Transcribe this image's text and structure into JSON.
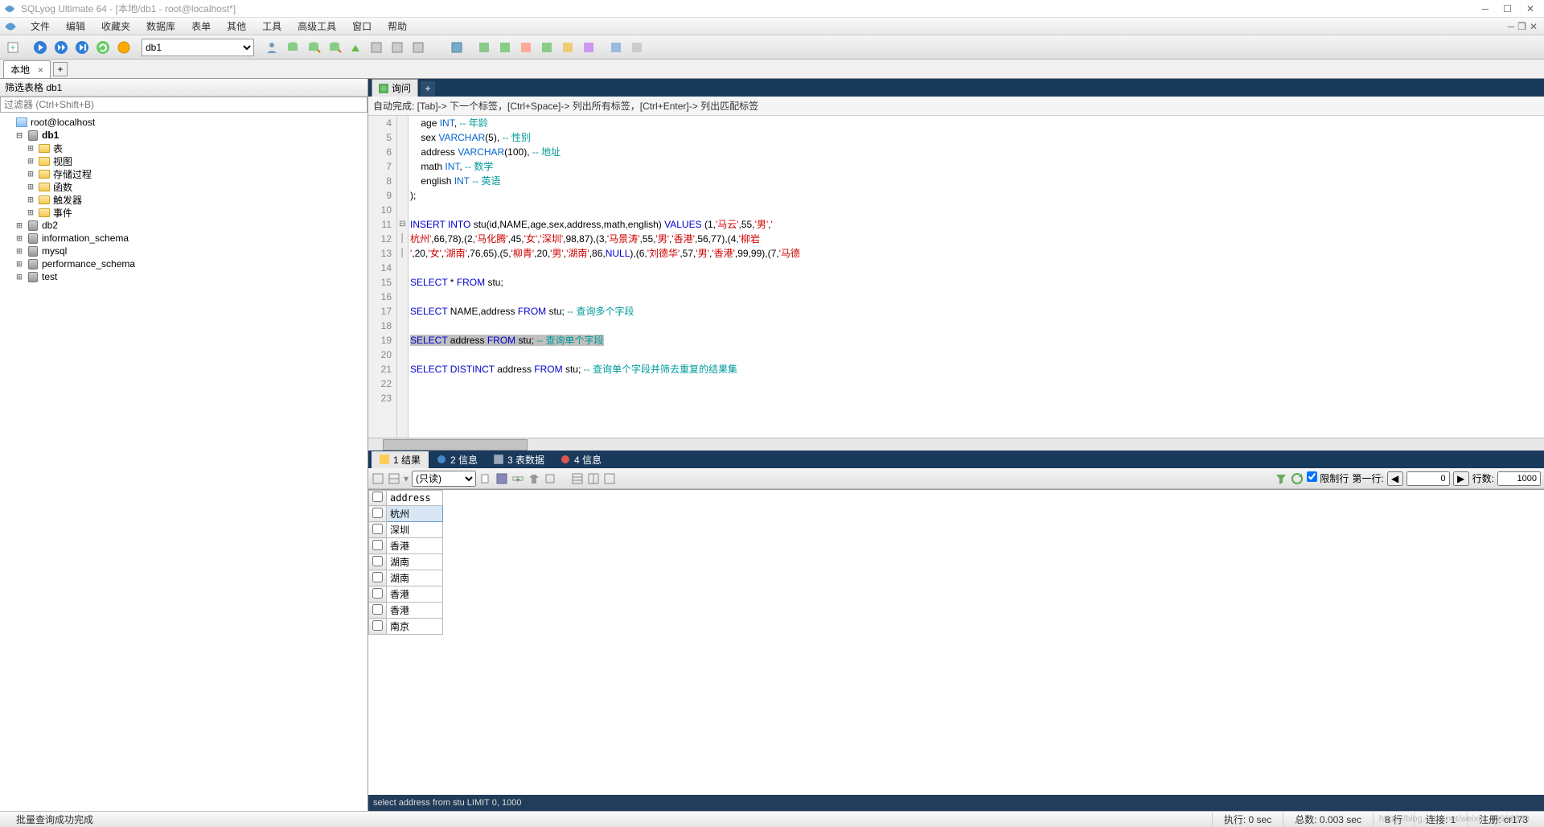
{
  "window": {
    "title": "SQLyog Ultimate 64 - [本地/db1 - root@localhost*]"
  },
  "menubar": {
    "items": [
      "文件",
      "编辑",
      "收藏夹",
      "数据库",
      "表单",
      "其他",
      "工具",
      "高级工具",
      "窗口",
      "帮助"
    ]
  },
  "toolbar": {
    "db_selector": "db1"
  },
  "conn_tab": {
    "label": "本地"
  },
  "sidebar": {
    "filter_label": "筛选表格 db1",
    "filter_placeholder": "过滤器 (Ctrl+Shift+B)",
    "root": "root@localhost",
    "db1": {
      "name": "db1",
      "children": [
        "表",
        "视图",
        "存储过程",
        "函数",
        "触发器",
        "事件"
      ]
    },
    "others": [
      "db2",
      "information_schema",
      "mysql",
      "performance_schema",
      "test"
    ]
  },
  "query_tab": {
    "label": "询问"
  },
  "autocomplete_hint": "自动完成:  [Tab]-> 下一个标签，[Ctrl+Space]-> 列出所有标签，[Ctrl+Enter]-> 列出匹配标签",
  "editor": {
    "lines": {
      "4": {
        "indent": "    ",
        "col": "age ",
        "type": "INT",
        "post": ", ",
        "comment": "-- 年龄"
      },
      "5": {
        "indent": "    ",
        "col": "sex ",
        "type": "VARCHAR",
        "args": "(5)",
        "post": ", ",
        "comment": "-- 性别"
      },
      "6": {
        "indent": "    ",
        "col": "address ",
        "type": "VARCHAR",
        "args": "(100)",
        "post": ", ",
        "comment": "-- 地址"
      },
      "7": {
        "indent": "    ",
        "col": "math ",
        "type": "INT",
        "post": ", ",
        "comment": "-- 数学"
      },
      "8": {
        "indent": "    ",
        "col": "english ",
        "type": "INT",
        "post": " ",
        "comment": "-- 英语"
      },
      "9": {
        "text": ");"
      },
      "11": {
        "kw": "INSERT INTO",
        "rest": " stu(id,NAME,age,sex,address,math,english) ",
        "kw2": "VALUES",
        "rest2": " (1,",
        "s1": "'马云'",
        "r3": ",55,",
        "s2": "'男'",
        "r4": ",",
        "s3": "'"
      },
      "12": {
        "s1": "杭州'",
        "r1": ",66,78),(2,",
        "s2": "'马化腾'",
        "r2": ",45,",
        "s3": "'女'",
        "r3": ",",
        "s4": "'深圳'",
        "r4": ",98,87),(3,",
        "s5": "'马景涛'",
        "r5": ",55,",
        "s6": "'男'",
        "r6": ",",
        "s7": "'香港'",
        "r7": ",56,77),(4,",
        "s8": "'柳岩"
      },
      "13": {
        "s1": "'",
        "r1": ",20,",
        "s2": "'女'",
        "r2": ",",
        "s3": "'湖南'",
        "r3": ",76,65),(5,",
        "s4": "'柳青'",
        "r4": ",20,",
        "s5": "'男'",
        "r5": ",",
        "s6": "'湖南'",
        "r6": ",86,",
        "kw": "NULL",
        "r7": "),(6,",
        "s7": "'刘德华'",
        "r8": ",57,",
        "s8": "'男'",
        "r9": ",",
        "s9": "'香港'",
        "r10": ",99,99),(7,",
        "s10": "'马德"
      },
      "15": {
        "kw": "SELECT",
        "r1": " * ",
        "kw2": "FROM",
        "r2": " stu;"
      },
      "17": {
        "kw": "SELECT",
        "r1": " NAME,address ",
        "kw2": "FROM",
        "r2": " stu; ",
        "cm": "-- 查询多个字段"
      },
      "19": {
        "kw": "SELECT",
        "r1": " address ",
        "kw2": "FROM",
        "r2": " stu; ",
        "cm": "-- 查询单个字段"
      },
      "21": {
        "kw": "SELECT",
        "kw1b": " DISTINCT",
        "r1": " address ",
        "kw2": "FROM",
        "r2": " stu; ",
        "cm": "-- 查询单个字段并筛去重复的结果集"
      }
    }
  },
  "result_tabs": [
    "1 结果",
    "2 信息",
    "3 表数据",
    "4 信息"
  ],
  "result_toolbar": {
    "mode": "(只读)",
    "limit_label": "限制行",
    "first_row_label": "第一行:",
    "first_row": "0",
    "rows_label": "行数:",
    "rows": "1000"
  },
  "grid": {
    "header": "address",
    "rows": [
      "杭州",
      "深圳",
      "香港",
      "湖南",
      "湖南",
      "香港",
      "香港",
      "南京"
    ]
  },
  "result_footer": "select address from stu LIMIT 0, 1000",
  "status": {
    "msg": "批量查询成功完成",
    "exec": "执行:  0 sec",
    "total": "总数:  0.003 sec",
    "rows": "8 行",
    "conn": "连接:  1",
    "reg": "注册:  cr173"
  },
  "watermark": "https://blog.csdn.net/weixin_40982880"
}
